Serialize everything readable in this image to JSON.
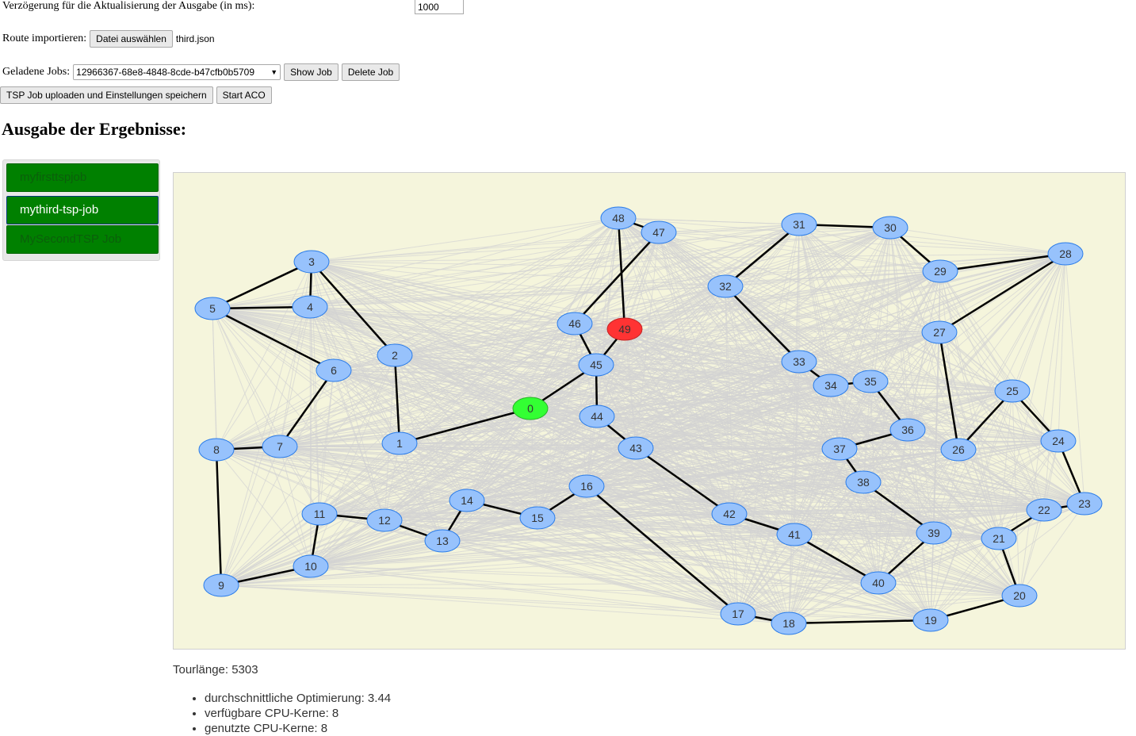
{
  "form": {
    "delay_label": "Verzögerung für die Aktualisierung der Ausgabe (in ms):",
    "delay_value": "1000",
    "import_label": "Route importieren:",
    "file_button": "Datei auswählen",
    "file_name": "third.json",
    "jobs_label": "Geladene Jobs:",
    "selected_job": "12966367-68e8-4848-8cde-b47cfb0b5709",
    "show_job": "Show Job",
    "delete_job": "Delete Job",
    "upload_button": "TSP Job uploaden und Einstellungen speichern",
    "start_button": "Start ACO"
  },
  "results": {
    "heading": "Ausgabe der Ergebnisse:",
    "jobs": [
      "myfirsttspjob",
      "mythird-tsp-job",
      "MySecondTSP Job"
    ],
    "active_job_index": 1,
    "tour_length": "Tourlänge: 5303",
    "stats": [
      "durchschnittliche Optimierung: 3.44",
      "verfügbare CPU-Kerne: 8",
      "genutzte CPU-Kerne: 8"
    ]
  },
  "graph": {
    "start_node": "0",
    "end_node": "49",
    "colors": {
      "background": "#f5f5dc",
      "node": "#97c2fc",
      "node_border": "#2b7ce9",
      "start": "#33ff33",
      "end": "#ff3333",
      "edge": "#d3d3d3",
      "tour": "#000000"
    },
    "nodes": [
      "0",
      "1",
      "2",
      "3",
      "4",
      "5",
      "6",
      "7",
      "8",
      "9",
      "10",
      "11",
      "12",
      "13",
      "14",
      "15",
      "16",
      "17",
      "18",
      "19",
      "20",
      "21",
      "22",
      "23",
      "24",
      "25",
      "26",
      "27",
      "28",
      "29",
      "30",
      "31",
      "32",
      "33",
      "34",
      "35",
      "36",
      "37",
      "38",
      "39",
      "40",
      "41",
      "42",
      "43",
      "44",
      "45",
      "46",
      "47",
      "48",
      "49"
    ],
    "tour": [
      [
        "0",
        "1"
      ],
      [
        "1",
        "2"
      ],
      [
        "2",
        "3"
      ],
      [
        "3",
        "4"
      ],
      [
        "3",
        "5"
      ],
      [
        "4",
        "5"
      ],
      [
        "5",
        "6"
      ],
      [
        "6",
        "7"
      ],
      [
        "7",
        "8"
      ],
      [
        "8",
        "9"
      ],
      [
        "9",
        "10"
      ],
      [
        "10",
        "11"
      ],
      [
        "11",
        "12"
      ],
      [
        "12",
        "13"
      ],
      [
        "13",
        "14"
      ],
      [
        "14",
        "15"
      ],
      [
        "15",
        "16"
      ],
      [
        "16",
        "17"
      ],
      [
        "17",
        "18"
      ],
      [
        "18",
        "19"
      ],
      [
        "19",
        "20"
      ],
      [
        "20",
        "21"
      ],
      [
        "21",
        "22"
      ],
      [
        "22",
        "23"
      ],
      [
        "23",
        "24"
      ],
      [
        "24",
        "25"
      ],
      [
        "25",
        "26"
      ],
      [
        "26",
        "27"
      ],
      [
        "27",
        "28"
      ],
      [
        "28",
        "29"
      ],
      [
        "29",
        "30"
      ],
      [
        "30",
        "31"
      ],
      [
        "31",
        "32"
      ],
      [
        "32",
        "33"
      ],
      [
        "33",
        "34"
      ],
      [
        "34",
        "35"
      ],
      [
        "35",
        "36"
      ],
      [
        "36",
        "37"
      ],
      [
        "37",
        "38"
      ],
      [
        "38",
        "39"
      ],
      [
        "39",
        "40"
      ],
      [
        "40",
        "41"
      ],
      [
        "41",
        "42"
      ],
      [
        "42",
        "43"
      ],
      [
        "43",
        "44"
      ],
      [
        "44",
        "45"
      ],
      [
        "45",
        "46"
      ],
      [
        "46",
        "47"
      ],
      [
        "47",
        "48"
      ],
      [
        "48",
        "49"
      ],
      [
        "49",
        "45"
      ],
      [
        "45",
        "0"
      ]
    ]
  }
}
